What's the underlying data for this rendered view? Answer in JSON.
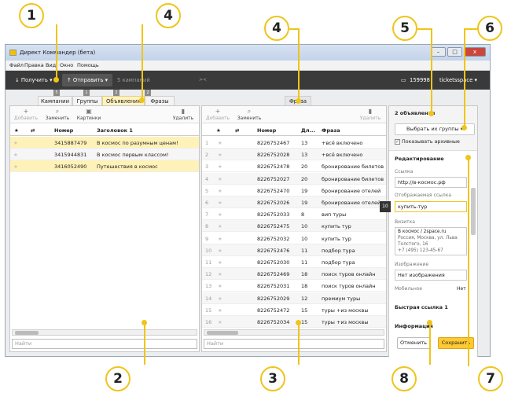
{
  "callouts": [
    "1",
    "2",
    "3",
    "4",
    "4",
    "5",
    "6",
    "7",
    "8"
  ],
  "window": {
    "title": "Директ Коммандер (бета)",
    "close": "x"
  },
  "menu": [
    "Файл",
    "Правка",
    "Вид",
    "Окно",
    "Помощь"
  ],
  "toolbar": {
    "get": "Получить",
    "send": "Отправить",
    "campaigns": "5 кампаний",
    "balance": "159998",
    "login": "ticketsspace"
  },
  "tab_numbers": [
    "5",
    "1",
    "2",
    "2"
  ],
  "tabs": [
    "Кампании",
    "Группы",
    "Объявления",
    "Фразы"
  ],
  "phrase_tab": "Фраза",
  "left_pane": {
    "actions": {
      "add": "Добавить",
      "replace": "Заменить",
      "images": "Картинки",
      "delete": "Удалить"
    },
    "headers": {
      "star": "★",
      "num": "Номер",
      "title": "Заголовок 1"
    },
    "rows": [
      {
        "num": "3415887479",
        "title": "В космос по разумным ценам!"
      },
      {
        "num": "3415944831",
        "title": "В космос первым классом!"
      },
      {
        "num": "3416052490",
        "title": "Путешествия в космос"
      }
    ],
    "search": "Найти"
  },
  "mid_pane": {
    "actions": {
      "add": "Добавить",
      "replace": "Заменить",
      "delete": "Удалить"
    },
    "headers": {
      "star": "★",
      "num": "Номер",
      "len": "Дл...",
      "phrase": "Фраза"
    },
    "rows": [
      {
        "i": "1",
        "num": "8226752467",
        "len": "13",
        "phrase": "+всё включено"
      },
      {
        "i": "2",
        "num": "8226752028",
        "len": "13",
        "phrase": "+всё включено"
      },
      {
        "i": "3",
        "num": "8226752478",
        "len": "20",
        "phrase": "бронирование билетов"
      },
      {
        "i": "4",
        "num": "8226752027",
        "len": "20",
        "phrase": "бронирование билетов"
      },
      {
        "i": "5",
        "num": "8226752470",
        "len": "19",
        "phrase": "бронирование отелей"
      },
      {
        "i": "6",
        "num": "8226752026",
        "len": "19",
        "phrase": "бронирование отелей"
      },
      {
        "i": "7",
        "num": "8226752033",
        "len": "8",
        "phrase": "вип туры"
      },
      {
        "i": "8",
        "num": "8226752475",
        "len": "10",
        "phrase": "купить тур"
      },
      {
        "i": "9",
        "num": "8226752032",
        "len": "10",
        "phrase": "купить тур"
      },
      {
        "i": "10",
        "num": "8226752476",
        "len": "11",
        "phrase": "подбор тура"
      },
      {
        "i": "11",
        "num": "8226752030",
        "len": "11",
        "phrase": "подбор тура"
      },
      {
        "i": "12",
        "num": "8226752469",
        "len": "18",
        "phrase": "поиск туров онлайн"
      },
      {
        "i": "13",
        "num": "8226752031",
        "len": "18",
        "phrase": "поиск туров онлайн"
      },
      {
        "i": "14",
        "num": "8226752029",
        "len": "12",
        "phrase": "премиум туры"
      },
      {
        "i": "15",
        "num": "8226752472",
        "len": "15",
        "phrase": "туры +из москвы"
      },
      {
        "i": "16",
        "num": "8226752034",
        "len": "15",
        "phrase": "туры +из москвы"
      }
    ],
    "search": "Найти"
  },
  "right_pane": {
    "count": "2 объявления",
    "select_groups": "Выбрать их группы",
    "show_archived": "Показывать архивные",
    "editing": "Редактирование",
    "link_label": "Ссылка",
    "link_value": "http://в-космос.рф",
    "display_label": "Отображаемая ссылка",
    "display_value": "купить-тур",
    "display_count": "10",
    "vcard_label": "Визитка",
    "vcard_lines": [
      "В космос / 2space.ru",
      "Россия, Москва, ул. Льва",
      "Толстого, 16",
      "+7 (495) 123-45-67"
    ],
    "image_label": "Изображение",
    "image_value": "Нет изображения",
    "mobile_label": "Мобильное",
    "mobile_value": "Нет",
    "quicklink": "Быстрая ссылка 1",
    "info": "Информация",
    "cancel": "Отменить",
    "save": "Сохранить"
  }
}
